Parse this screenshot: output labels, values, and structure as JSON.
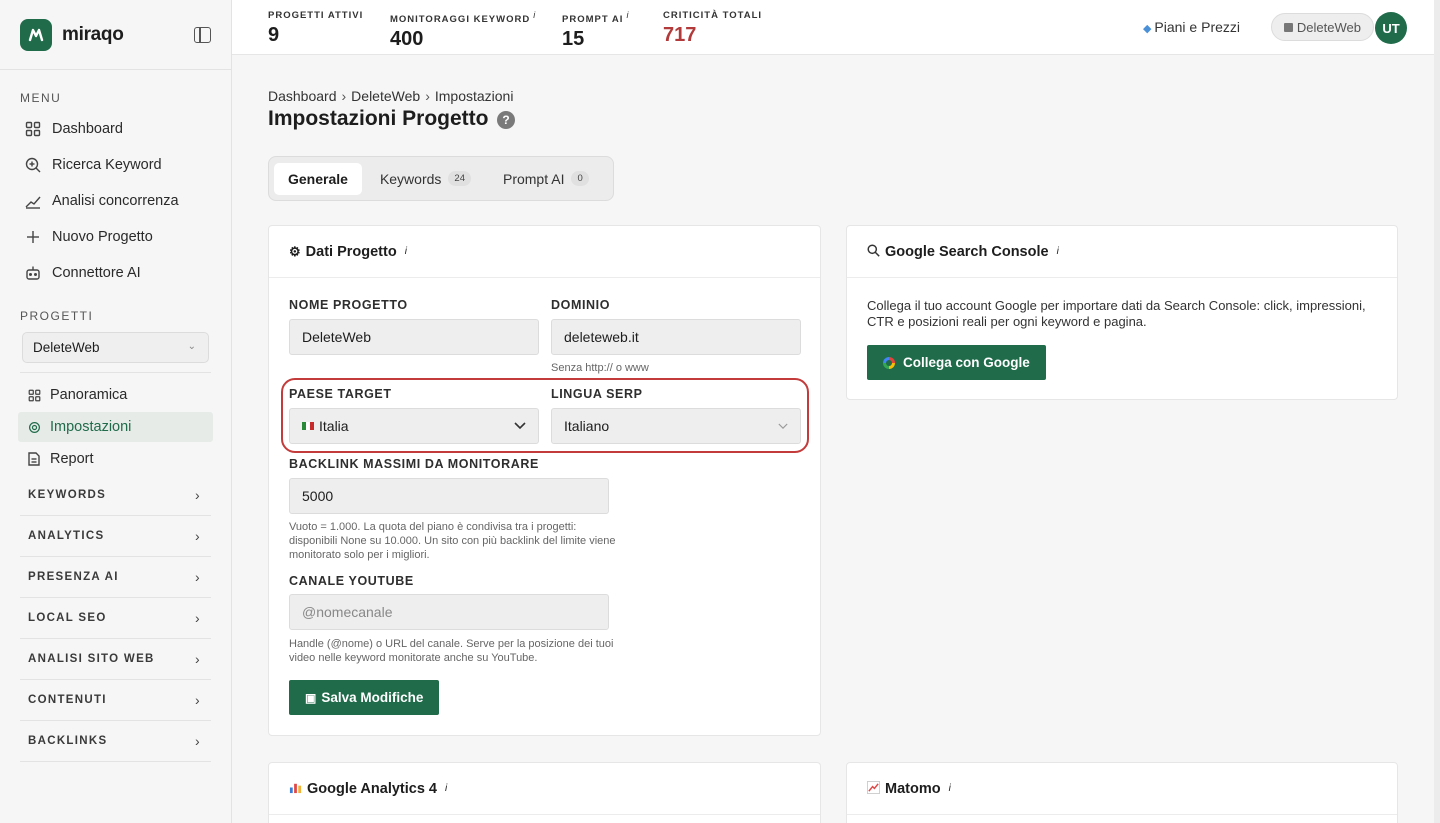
{
  "brand": {
    "name": "miraqo"
  },
  "sidebar": {
    "menu_title": "MENU",
    "menu_items": [
      {
        "label": "Dashboard",
        "icon": "grid-icon"
      },
      {
        "label": "Ricerca Keyword",
        "icon": "search-plus-icon"
      },
      {
        "label": "Analisi concorrenza",
        "icon": "trend-chart-icon"
      },
      {
        "label": "Nuovo Progetto",
        "icon": "plus-icon"
      },
      {
        "label": "Connettore AI",
        "icon": "robot-icon"
      }
    ],
    "projects_title": "PROGETTI",
    "project_selected": "DeleteWeb",
    "project_items": [
      {
        "label": "Panoramica",
        "icon": "grid-icon",
        "active": false
      },
      {
        "label": "Impostazioni",
        "icon": "gear-icon",
        "active": true
      },
      {
        "label": "Report",
        "icon": "document-icon",
        "active": false
      }
    ],
    "groups": [
      "KEYWORDS",
      "ANALYTICS",
      "PRESENZA AI",
      "LOCAL SEO",
      "ANALISI SITO WEB",
      "CONTENUTI",
      "BACKLINKS"
    ]
  },
  "topbar": {
    "stats": [
      {
        "label": "PROGETTI ATTIVI",
        "value": "9",
        "info": ""
      },
      {
        "label": "MONITORAGGI KEYWORD",
        "value": "400",
        "info": "i"
      },
      {
        "label": "PROMPT AI",
        "value": "15",
        "info": "i"
      },
      {
        "label": "CRITICITÀ TOTALI",
        "value": "717",
        "info": ""
      }
    ],
    "plans_label": "Piani e Prezzi",
    "project_pill": "DeleteWeb",
    "avatar_initials": "UT"
  },
  "breadcrumb": [
    "Dashboard",
    "DeleteWeb",
    "Impostazioni"
  ],
  "breadcrumb_sep": "›",
  "page_title": "Impostazioni Progetto",
  "help_glyph": "?",
  "tabs": [
    {
      "label": "Generale",
      "count": null,
      "active": true
    },
    {
      "label": "Keywords",
      "count": "24",
      "active": false
    },
    {
      "label": "Prompt AI",
      "count": "0",
      "active": false
    }
  ],
  "dati_progetto": {
    "title": "Dati Progetto",
    "info": "i",
    "nome_label": "NOME PROGETTO",
    "nome_value": "DeleteWeb",
    "dominio_label": "DOMINIO",
    "dominio_value": "deleteweb.it",
    "dominio_help": "Senza http:// o www",
    "paese_label": "PAESE TARGET",
    "paese_value": "Italia",
    "lingua_label": "LINGUA SERP",
    "lingua_value": "Italiano",
    "backlink_label": "BACKLINK MASSIMI DA MONITORARE",
    "backlink_value": "5000",
    "backlink_help": "Vuoto = 1.000. La quota del piano è condivisa tra i progetti: disponibili None su 10.000. Un sito con più backlink del limite viene monitorato solo per i migliori.",
    "youtube_label": "CANALE YOUTUBE",
    "youtube_placeholder": "@nomecanale",
    "youtube_help": "Handle (@nome) o URL del canale. Serve per la posizione dei tuoi video nelle keyword monitorate anche su YouTube.",
    "save_label": "Salva Modifiche"
  },
  "gsc": {
    "title": "Google Search Console",
    "info": "i",
    "description": "Collega il tuo account Google per importare dati da Search Console: click, impressioni, CTR e posizioni reali per ogni keyword e pagina.",
    "button_label": "Collega con Google"
  },
  "ga4": {
    "title": "Google Analytics 4",
    "info": "i"
  },
  "matomo": {
    "title": "Matomo",
    "info": "i"
  },
  "colors": {
    "brand": "#1f6b4a",
    "critical": "#b23a3a",
    "highlight": "#c43b3b"
  }
}
